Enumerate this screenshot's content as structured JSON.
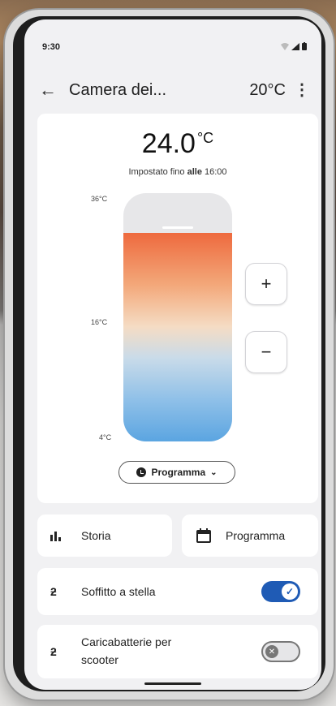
{
  "status": {
    "time": "9:30"
  },
  "header": {
    "title": "Camera dei...",
    "current_temp": "20°C"
  },
  "thermostat": {
    "temp_value": "24.0",
    "temp_unit": "°C",
    "setpoint_prefix": "Impostato fino",
    "setpoint_bold": "alle",
    "setpoint_time": "16:00",
    "scale_max": "36°C",
    "scale_mid": "16°C",
    "scale_min": "4°C",
    "fill_fraction": 0.84,
    "plus_label": "+",
    "minus_label": "−",
    "mode_label": "Programma",
    "colors": {
      "warm": "#ee6a3e",
      "cool": "#5ba5e1"
    }
  },
  "actions": {
    "history_label": "Storia",
    "schedule_label": "Programma"
  },
  "devices": [
    {
      "label": "Soffitto a stella",
      "on": true
    },
    {
      "label_line1": "Caricabatterie per",
      "label_line2": "scooter",
      "on": false
    }
  ],
  "accent_color": "#1f5bb5"
}
